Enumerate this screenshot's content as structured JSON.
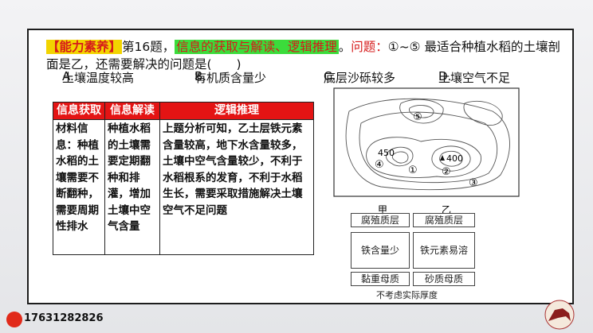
{
  "question": {
    "tag": "【能力素养】",
    "number_text": "第16题，",
    "skill_text": "信息的获取与解读、逻辑推理",
    "after_skill": "。",
    "prompt_label": "问题：",
    "prompt_body": "①~⑤ 最适合种植水稻的土壤剖面是乙，还需要解决的问题是(　　)"
  },
  "options": [
    {
      "letter": "A.",
      "text": "土壤温度较高"
    },
    {
      "letter": "B.",
      "text": "有机质含量少"
    },
    {
      "letter": "C.",
      "text": "底层沙砾较多"
    },
    {
      "letter": "D.",
      "text": "土壤空气不足"
    }
  ],
  "table": {
    "headers": [
      "信息获取",
      "信息解读",
      "逻辑推理"
    ],
    "col1": "材料信息：种植水稻的土壤需要不断翻种，需要周期性排水",
    "col2": "种植水稻的土壤需要定期翻种和排灌，增加土壤中空气含量",
    "col3": "上题分析可知，乙土层铁元素含量较高，地下水含量较多，土壤中空气含量较少，不利于水稻根系的发育，不利于水稻生长，需要采取措施解决土壤空气不足问题"
  },
  "map": {
    "labels": [
      "⑤",
      "④",
      "①",
      "②",
      "③"
    ],
    "elevation_450": "450",
    "peak_400": "400"
  },
  "profile": {
    "left_title": "甲",
    "right_title": "乙",
    "left_layers": [
      "腐殖质层",
      "铁含量少",
      "黏重母质"
    ],
    "right_layers": [
      "腐殖质层",
      "铁元素易溶",
      "砂质母质"
    ],
    "note": "不考虑实际厚度"
  },
  "footer": {
    "phone": "17631282826"
  }
}
